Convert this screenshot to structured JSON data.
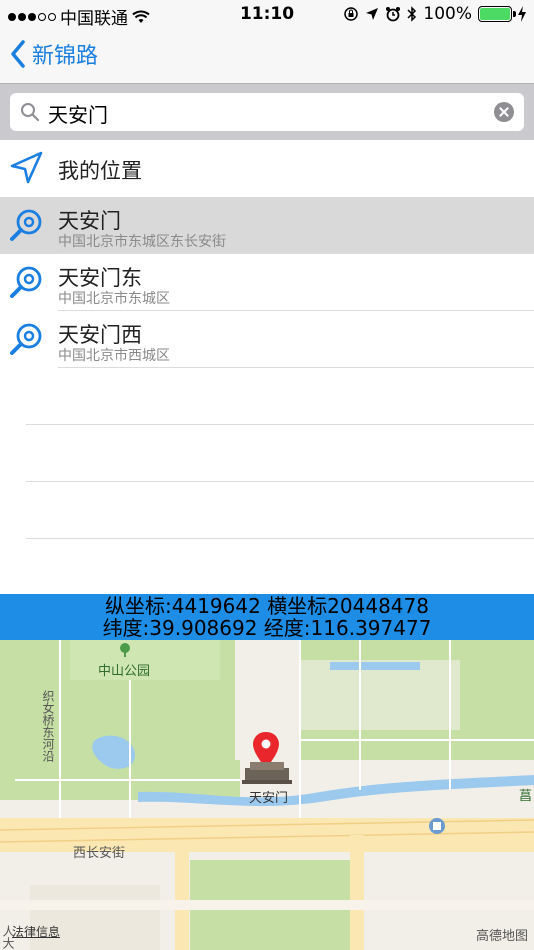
{
  "status_bar": {
    "carrier": "中国联通",
    "time": "11:10",
    "battery": "100%"
  },
  "nav": {
    "back_label": "新锦路"
  },
  "search": {
    "value": "天安门"
  },
  "list": {
    "my_location": "我的位置",
    "results": [
      {
        "title": "天安门",
        "subtitle": "中国北京市东城区东长安街",
        "selected": true
      },
      {
        "title": "天安门东",
        "subtitle": "中国北京市东城区",
        "selected": false
      },
      {
        "title": "天安门西",
        "subtitle": "中国北京市西城区",
        "selected": false
      }
    ]
  },
  "coords": {
    "line1": "纵坐标:4419642 横坐标20448478",
    "line2": "纬度:39.908692 经度:116.397477"
  },
  "map": {
    "labels": {
      "park": "中山公园",
      "river_road": "织女桥东河沿",
      "landmark": "天安门",
      "street": "西长安街",
      "edge_right": "菖",
      "edge_left": "人大"
    },
    "legal": "法律信息",
    "brand": "高德地图",
    "colors": {
      "pin": "#e8262b",
      "water": "#9cc9ee",
      "green": "#c5dfa5",
      "road": "#fbe7b2"
    }
  },
  "colors": {
    "accent": "#1a7fe0",
    "banner": "#1e8de6"
  }
}
